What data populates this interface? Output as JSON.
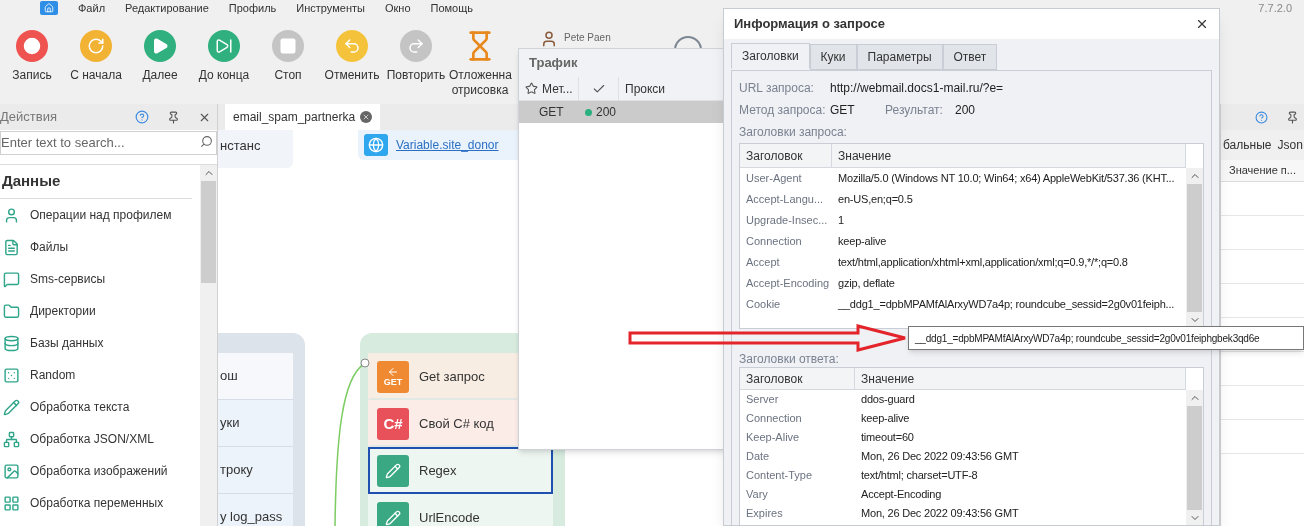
{
  "menu": [
    "Файл",
    "Редактирование",
    "Профиль",
    "Инструменты",
    "Окно",
    "Помощь"
  ],
  "version": "7.7.2.0",
  "toolbar": [
    {
      "label": "Запись",
      "kind": "record",
      "disabled": false
    },
    {
      "label": "С начала",
      "kind": "restart",
      "disabled": false
    },
    {
      "label": "Далее",
      "kind": "play",
      "disabled": false
    },
    {
      "label": "До конца",
      "kind": "end",
      "disabled": false
    },
    {
      "label": "Стоп",
      "kind": "stop",
      "disabled": true
    },
    {
      "label": "Отменить",
      "kind": "undo",
      "disabled": false
    },
    {
      "label": "Повторить",
      "kind": "redo",
      "disabled": true
    },
    {
      "label": "Отложенна отрисовка",
      "kind": "deferred",
      "disabled": false
    }
  ],
  "user": {
    "name": "Pete Paen"
  },
  "actions": {
    "title": "Действия",
    "search_placeholder": "Enter text to search...",
    "section": "Данные",
    "items": [
      {
        "label": "Операции над профилем"
      },
      {
        "label": "Файлы"
      },
      {
        "label": "Sms-сервисы"
      },
      {
        "label": "Директории"
      },
      {
        "label": "Базы данных"
      },
      {
        "label": "Random"
      },
      {
        "label": "Обработка текста"
      },
      {
        "label": "Обработка JSON/XML"
      },
      {
        "label": "Обработка изображений"
      },
      {
        "label": "Обработка переменных"
      }
    ]
  },
  "document_tab": {
    "label": "email_spam_partnerka"
  },
  "canvas": {
    "top_nodes": [
      {
        "text": "нстанс",
        "kind": "plain"
      },
      {
        "text": "Variable.site_donor",
        "kind": "link"
      }
    ],
    "left_group": [
      "ош",
      "уки",
      "троку",
      "y log_pass"
    ],
    "right_group": [
      {
        "label": "Get запрос",
        "kind": "get",
        "icon_text": "GET",
        "selected": false
      },
      {
        "label": "Свой C# код",
        "kind": "csharp",
        "icon_text": "C#",
        "selected": false
      },
      {
        "label": "Regex",
        "kind": "pencil",
        "selected": true
      },
      {
        "label": "UrlEncode",
        "kind": "pencil",
        "selected": false
      }
    ]
  },
  "right_panel": {
    "columns": [
      "бальные",
      "Json"
    ],
    "header": "Значение п..."
  },
  "traffic": {
    "title": "Трафик",
    "columns": [
      {
        "kind": "star",
        "label": "Мет..."
      },
      {
        "kind": "check"
      },
      {
        "kind": "text",
        "label": "Прокси"
      }
    ],
    "rows": [
      {
        "method": "GET",
        "status": "200",
        "color": "#2bb07f",
        "selected": true
      }
    ]
  },
  "dialog": {
    "title": "Информация о запросе",
    "tabs": [
      {
        "label": "Заголовки",
        "selected": true
      },
      {
        "label": "Куки",
        "selected": false
      },
      {
        "label": "Параметры",
        "selected": false
      },
      {
        "label": "Ответ",
        "selected": false
      }
    ],
    "url_label": "URL запроса:",
    "url": "http://webmail.docs1-mail.ru/?e=",
    "method_label": "Метод запроса:",
    "method": "GET",
    "result_label": "Результат:",
    "result": "200",
    "request_title": "Заголовки запроса:",
    "request_columns": [
      "Заголовок",
      "Значение"
    ],
    "request_headers": [
      {
        "name": "User-Agent",
        "value": "Mozilla/5.0 (Windows NT 10.0; Win64; x64) AppleWebKit/537.36 (KHT..."
      },
      {
        "name": "Accept-Langu...",
        "value": "en-US,en;q=0.5"
      },
      {
        "name": "Upgrade-Insec...",
        "value": "1"
      },
      {
        "name": "Connection",
        "value": "keep-alive"
      },
      {
        "name": "Accept",
        "value": "text/html,application/xhtml+xml,application/xml;q=0.9,*/*;q=0.8"
      },
      {
        "name": "Accept-Encoding",
        "value": "gzip, deflate"
      },
      {
        "name": "Cookie",
        "value": "__ddg1_=dpbMPAMfAlArxyWD7a4p; roundcube_sessid=2g0v01feiph..."
      }
    ],
    "response_title": "Заголовки ответа:",
    "response_columns": [
      "Заголовок",
      "Значение"
    ],
    "response_headers": [
      {
        "name": "Server",
        "value": "ddos-guard"
      },
      {
        "name": "Connection",
        "value": "keep-alive"
      },
      {
        "name": "Keep-Alive",
        "value": "timeout=60"
      },
      {
        "name": "Date",
        "value": "Mon, 26 Dec 2022 09:43:56 GMT"
      },
      {
        "name": "Content-Type",
        "value": "text/html; charset=UTF-8"
      },
      {
        "name": "Vary",
        "value": "Accept-Encoding"
      },
      {
        "name": "Expires",
        "value": "Mon, 26 Dec 2022 09:43:56 GMT"
      }
    ]
  },
  "tooltip": {
    "text": "__ddg1_=dpbMPAMfAlArxyWD7a4p; roundcube_sessid=2g0v01feiphgbek3qd6e"
  }
}
